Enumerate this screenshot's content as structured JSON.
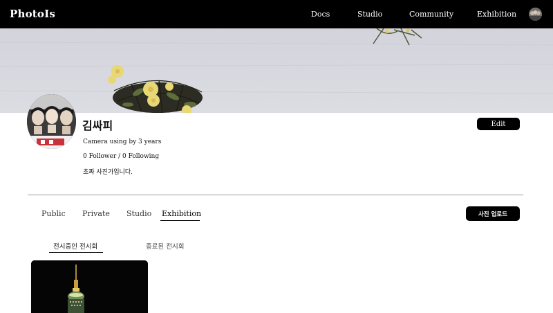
{
  "navbar": {
    "logo": "PhotoIs",
    "links": [
      "Docs",
      "Studio",
      "Community",
      "Exhibition"
    ]
  },
  "profile": {
    "username": "김싸피",
    "camera_text": "Camera using by 3 years",
    "follow_text": "0 Follower / 0 Following",
    "intro": "초짜 사진가입니다.",
    "edit_label": "Edit"
  },
  "tabs": {
    "items": [
      "Public",
      "Private",
      "Studio",
      "Exhibition"
    ],
    "active": "Exhibition"
  },
  "upload_label": "사진 업로드",
  "subtabs": {
    "items": [
      "전시중인 전시회",
      "종료된 전시회"
    ],
    "active": "전시중인 전시회"
  },
  "colors": {
    "navbar_bg": "#000000",
    "button_bg": "#000000",
    "cover_wall": "#d7d7de",
    "flower": "#e6d36b"
  },
  "icons": {
    "nav_avatar": "user-avatar-icon",
    "profile_avatar": "profile-photo-icon"
  }
}
